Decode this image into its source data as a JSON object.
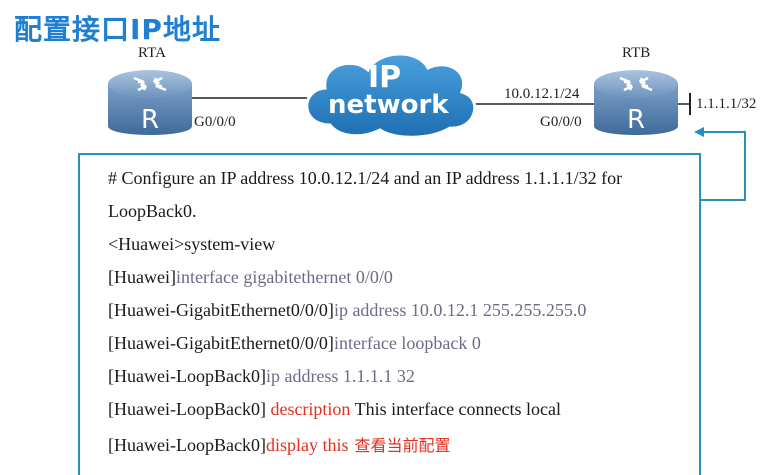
{
  "title": "配置接口IP地址",
  "diagram": {
    "rta": {
      "name": "RTA",
      "interface": "G0/0/0"
    },
    "rtb": {
      "name": "RTB",
      "interface": "G0/0/0",
      "ip": "10.0.12.1/24",
      "loopback": "1.1.1.1/32"
    },
    "cloud": {
      "line1": "IP",
      "line2": "network"
    }
  },
  "code": {
    "lines": [
      {
        "prompt": "# Configure an IP address 10.0.12.1/24 and an IP address 1.1.1.1/32 for",
        "cmd": "",
        "extra": "",
        "note": ""
      },
      {
        "prompt": "LoopBack0.",
        "cmd": "",
        "extra": "",
        "note": ""
      },
      {
        "prompt": "<Huawei>system-view",
        "cmd": "",
        "extra": "",
        "note": ""
      },
      {
        "prompt": "[Huawei]",
        "cmd": "interface gigabitethernet 0/0/0",
        "extra": "",
        "note": ""
      },
      {
        "prompt": "[Huawei-GigabitEthernet0/0/0]",
        "cmd": "ip address 10.0.12.1 255.255.255.0",
        "extra": "",
        "note": ""
      },
      {
        "prompt": "[Huawei-GigabitEthernet0/0/0]",
        "cmd": "interface loopback 0",
        "extra": "",
        "note": ""
      },
      {
        "prompt": "[Huawei-LoopBack0]",
        "cmd": "ip address 1.1.1.1 32",
        "extra": "",
        "note": ""
      },
      {
        "prompt": "[Huawei-LoopBack0] ",
        "cmd_red": "description",
        "extra": " This interface connects local",
        "note": ""
      },
      {
        "prompt": "[Huawei-LoopBack0]",
        "cmd_red": "display this",
        "extra": "",
        "note": "查看当前配置"
      }
    ]
  },
  "colors": {
    "title": "#1f7fd0",
    "panel_border": "#2a8fbd",
    "cloud": "#2a7fc0",
    "command_gray": "#6b6b8a",
    "command_red": "#e0301e"
  }
}
